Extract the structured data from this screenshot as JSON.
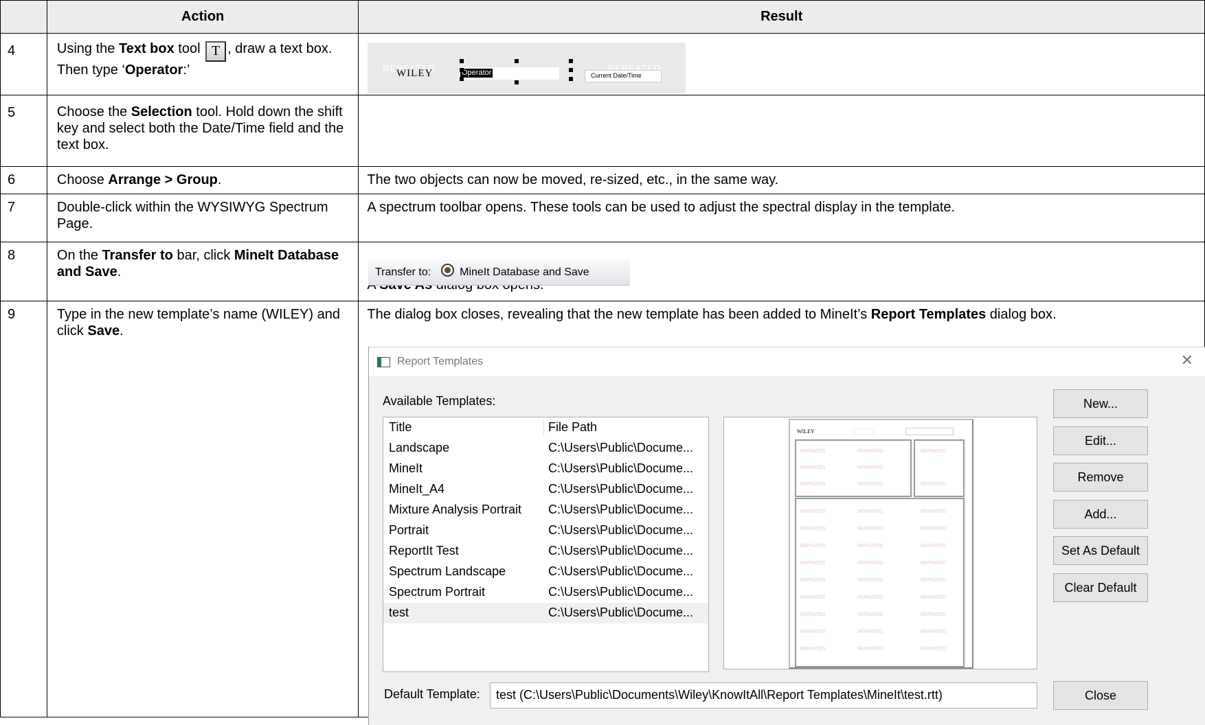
{
  "table": {
    "headers": [
      "Action",
      "Result"
    ],
    "rows": [
      {
        "num": "4"
      },
      {
        "num": "5"
      },
      {
        "num": "6"
      },
      {
        "num": "7"
      },
      {
        "num": "8"
      },
      {
        "num": "9"
      }
    ]
  },
  "row4": {
    "a1": "Using the ",
    "b1": "Text box",
    "a2": " tool ",
    "tool_glyph": "T",
    "a3": ", draw a text box. Then type ‘",
    "b2": "Operator",
    "a4": ":’",
    "shot": {
      "logo": "WILEY",
      "operator_field": "Operator",
      "date_field": "Current Date/Time",
      "ghost_text": "REPEATED"
    }
  },
  "row5": {
    "a1": "Choose the ",
    "b1": "Selection",
    "a2": " tool. Hold down the shift key and select both the Date/Time field and the text box."
  },
  "row6": {
    "a1": "Choose ",
    "b1": "Arrange > Group",
    "a2": ".",
    "result": "The two objects can now be moved, re-sized, etc., in the same way."
  },
  "row7": {
    "action": "Double-click within the WYSIWYG Spectrum Page.",
    "result": "A spectrum toolbar opens. These tools can be used to adjust the spectral display in the template."
  },
  "row8": {
    "a1": "On the ",
    "b1": "Transfer to",
    "a2": " bar, click ",
    "b2": "MineIt Database and Save",
    "a3": ".",
    "bar_label": "Transfer to:",
    "bar_button": "MineIt Database and Save",
    "r1": "A ",
    "rb1": "Save As",
    "r2": " dialog box opens."
  },
  "row9": {
    "a1": "Type in the new template’s name (WILEY) and click ",
    "b1": "Save",
    "a2": ".",
    "r1": "The dialog box closes, revealing that the new template has been added to MineIt’s ",
    "rb1": "Report Templates",
    "r2": " dialog box."
  },
  "dialog": {
    "title": "Report Templates",
    "available_label": "Available Templates:",
    "columns": [
      "Title",
      "File Path"
    ],
    "templates": [
      {
        "title": "Landscape",
        "path": "C:\\Users\\Public\\Docume..."
      },
      {
        "title": "MineIt",
        "path": "C:\\Users\\Public\\Docume..."
      },
      {
        "title": "MineIt_A4",
        "path": "C:\\Users\\Public\\Docume..."
      },
      {
        "title": "Mixture Analysis Portrait",
        "path": "C:\\Users\\Public\\Docume..."
      },
      {
        "title": "Portrait",
        "path": "C:\\Users\\Public\\Docume..."
      },
      {
        "title": "ReportIt Test",
        "path": "C:\\Users\\Public\\Docume..."
      },
      {
        "title": "Spectrum Landscape",
        "path": "C:\\Users\\Public\\Docume..."
      },
      {
        "title": "Spectrum Portrait",
        "path": "C:\\Users\\Public\\Docume..."
      },
      {
        "title": "test",
        "path": "C:\\Users\\Public\\Docume..."
      }
    ],
    "selected_template": "test",
    "buttons": [
      "New...",
      "Edit...",
      "Remove",
      "Add...",
      "Set As Default",
      "Clear Default"
    ],
    "close_button": "Close",
    "default_label": "Default Template:",
    "default_value": "test (C:\\Users\\Public\\Documents\\Wiley\\KnowItAll\\Report Templates\\MineIt\\test.rtt)",
    "preview": {
      "logo": "WILEY",
      "ghost_text": "REPEATED"
    }
  }
}
